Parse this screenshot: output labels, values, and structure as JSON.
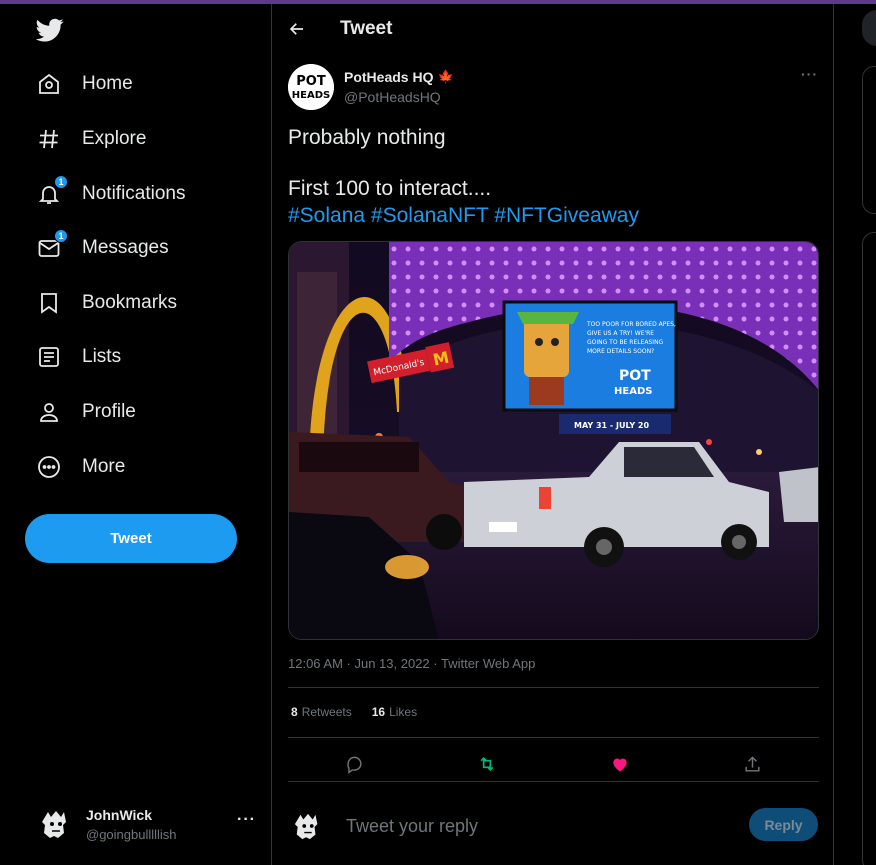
{
  "nav": {
    "items": [
      {
        "label": "Home",
        "icon": "home-icon"
      },
      {
        "label": "Explore",
        "icon": "hashtag-icon"
      },
      {
        "label": "Notifications",
        "icon": "bell-icon",
        "badge": "1"
      },
      {
        "label": "Messages",
        "icon": "envelope-icon",
        "badge": "1"
      },
      {
        "label": "Bookmarks",
        "icon": "bookmark-icon"
      },
      {
        "label": "Lists",
        "icon": "list-icon"
      },
      {
        "label": "Profile",
        "icon": "person-icon"
      },
      {
        "label": "More",
        "icon": "more-circle-icon"
      }
    ],
    "tweet_button": "Tweet"
  },
  "account": {
    "name": "JohnWick",
    "handle": "@goingbulllllish",
    "more": "···"
  },
  "header": {
    "title": "Tweet"
  },
  "tweet": {
    "author_name": "PotHeads HQ",
    "author_flag": "🍁",
    "author_handle": "@PotHeadsHQ",
    "menu": "···",
    "line1": "Probably nothing",
    "line2": "First 100 to interact....",
    "hashtags": [
      "#Solana",
      "#SolanaNFT",
      "#NFTGiveaway"
    ],
    "media": {
      "billboard_text": "TOO POOR FOR BORED APES, GIVE US A TRY! WE'RE GOING TO BE RELEASING MORE DETAILS SOON?",
      "billboard_dates": "MAY 31 - JULY 20",
      "sign_text": "McDonald's"
    },
    "timestamp": "12:06 AM · Jun 13, 2022 · Twitter Web App",
    "retweets_count": "8",
    "retweets_label": "Retweets",
    "likes_count": "16",
    "likes_label": "Likes"
  },
  "reply": {
    "placeholder": "Tweet your reply",
    "button": "Reply"
  },
  "colors": {
    "accent": "#1d9bf0",
    "retweet": "#00ba7c",
    "like": "#f91880"
  }
}
